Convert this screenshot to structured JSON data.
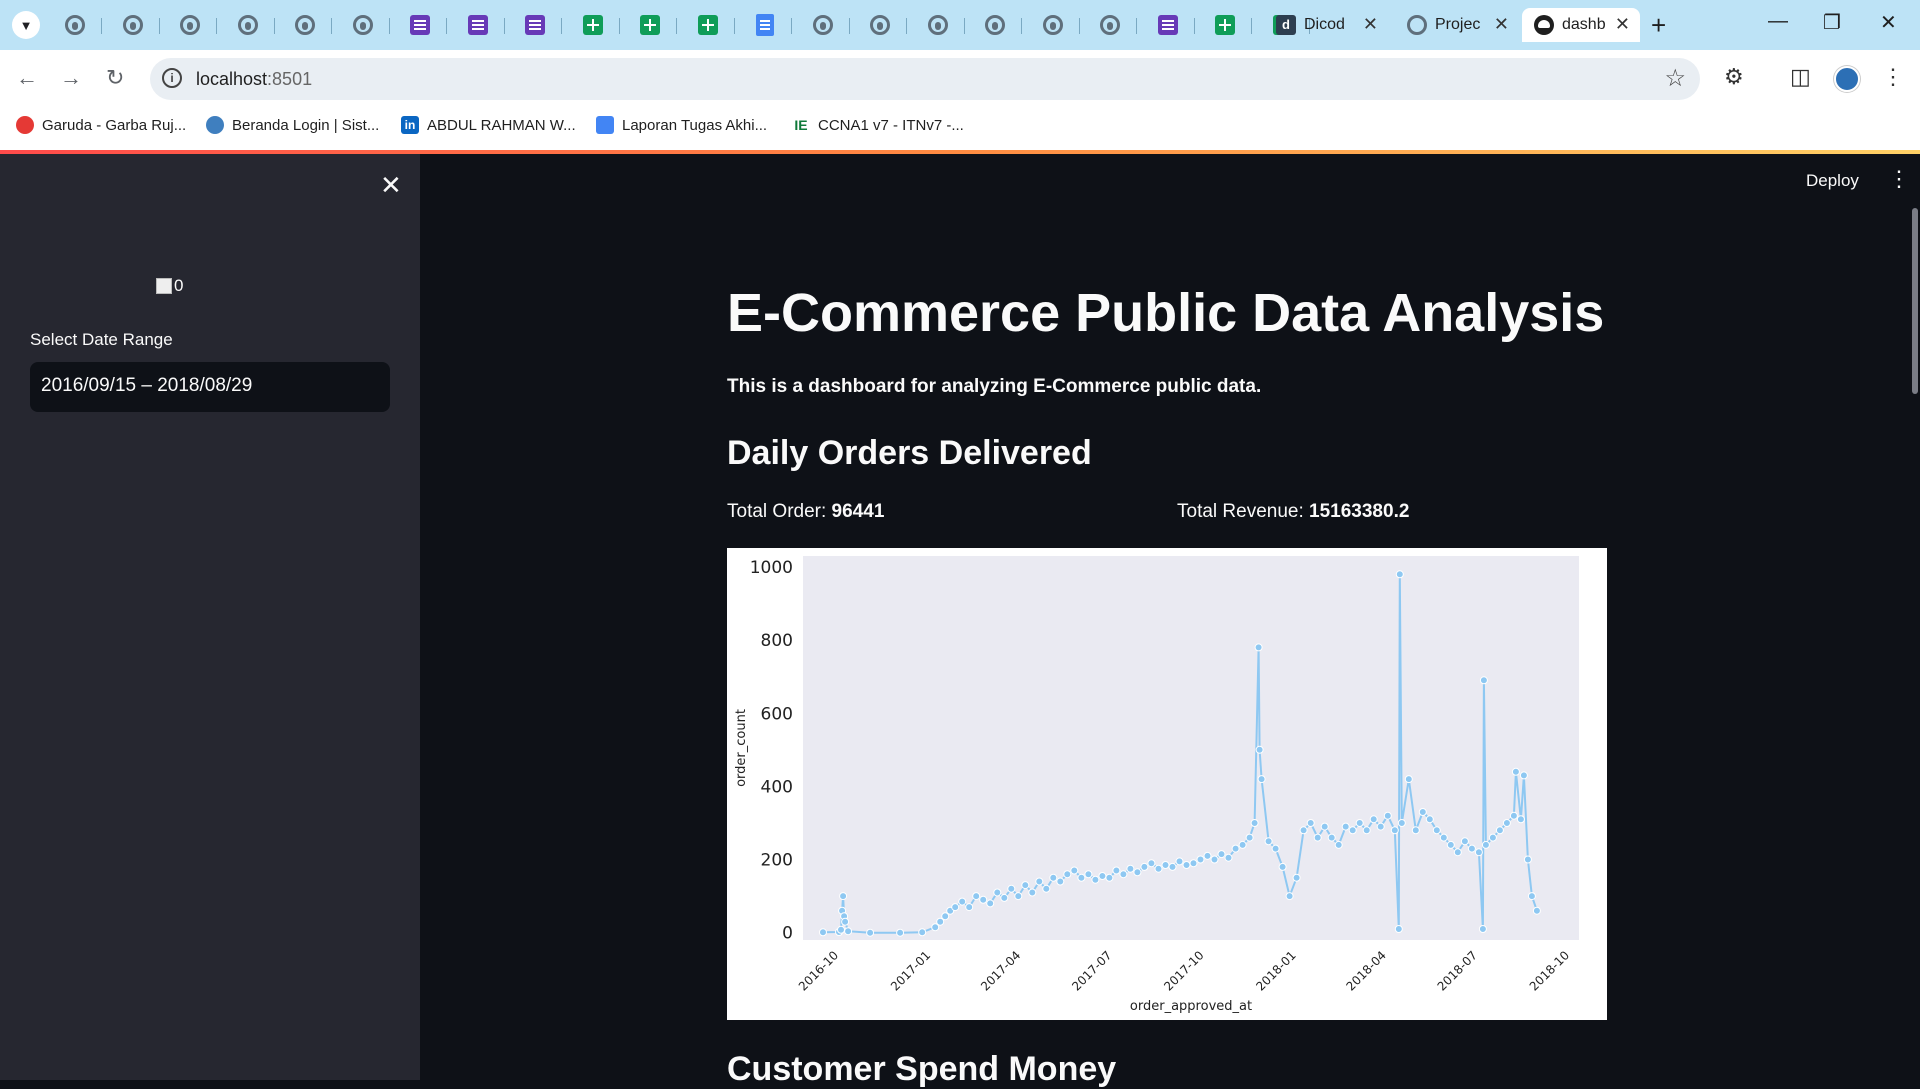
{
  "browser": {
    "pinned_tabs": [
      "github",
      "github",
      "github",
      "github",
      "github",
      "github",
      "forms",
      "forms",
      "forms",
      "sheets",
      "sheets",
      "sheets",
      "docs",
      "github",
      "github",
      "github",
      "github",
      "github",
      "github",
      "forms",
      "sheets",
      "sheets"
    ],
    "tabs": [
      {
        "title": "Dicod",
        "favicon": "dicoding-icon"
      },
      {
        "title": "Projec",
        "favicon": "github-icon"
      },
      {
        "title": "dashb",
        "favicon": "streamlit-icon",
        "active": true
      }
    ],
    "url_host": "localhost",
    "url_port": ":8501",
    "bookmarks": [
      "Garuda - Garba Ruj...",
      "Beranda Login | Sist...",
      "ABDUL RAHMAN W...",
      "Laporan Tugas Akhi...",
      "CCNA1 v7 - ITNv7 -..."
    ]
  },
  "sidebar": {
    "image_alt": "0",
    "date_label": "Select Date Range",
    "date_value": "2016/09/15 – 2018/08/29"
  },
  "header": {
    "deploy_label": "Deploy"
  },
  "main": {
    "title": "E-Commerce Public Data Analysis",
    "subtitle": "This is a dashboard for analyzing E-Commerce public data.",
    "section1": "Daily Orders Delivered",
    "total_order_label": "Total Order: ",
    "total_order_value": "96441",
    "total_revenue_label": "Total Revenue: ",
    "total_revenue_value": "15163380.2",
    "section2": "Customer Spend Money"
  },
  "colors": {
    "accent_line": "#8ec8f2",
    "plot_bg": "#eaeaf2",
    "sidebar_bg": "#262730",
    "app_bg": "#0e1117"
  },
  "chart_data": {
    "type": "line",
    "xlabel": "order_approved_at",
    "ylabel": "order_count",
    "ylim": [
      -20,
      1030
    ],
    "xlim": [
      "2016-08-26",
      "2018-10-10"
    ],
    "x_ticks": [
      "2016-10",
      "2017-01",
      "2017-04",
      "2017-07",
      "2017-10",
      "2018-01",
      "2018-04",
      "2018-07",
      "2018-10"
    ],
    "y_ticks": [
      0,
      200,
      400,
      600,
      800,
      1000
    ],
    "series": [
      {
        "marker": "o",
        "points": [
          [
            "2016-09-15",
            1
          ],
          [
            "2016-10-01",
            2
          ],
          [
            "2016-10-03",
            8
          ],
          [
            "2016-10-04",
            60
          ],
          [
            "2016-10-05",
            100
          ],
          [
            "2016-10-06",
            45
          ],
          [
            "2016-10-07",
            30
          ],
          [
            "2016-10-10",
            4
          ],
          [
            "2016-11-01",
            0
          ],
          [
            "2016-12-01",
            0
          ],
          [
            "2016-12-23",
            1
          ],
          [
            "2017-01-05",
            15
          ],
          [
            "2017-01-10",
            30
          ],
          [
            "2017-01-15",
            45
          ],
          [
            "2017-01-20",
            60
          ],
          [
            "2017-01-25",
            70
          ],
          [
            "2017-02-01",
            85
          ],
          [
            "2017-02-08",
            70
          ],
          [
            "2017-02-15",
            100
          ],
          [
            "2017-02-22",
            90
          ],
          [
            "2017-03-01",
            80
          ],
          [
            "2017-03-08",
            110
          ],
          [
            "2017-03-15",
            95
          ],
          [
            "2017-03-22",
            120
          ],
          [
            "2017-03-29",
            100
          ],
          [
            "2017-04-05",
            130
          ],
          [
            "2017-04-12",
            110
          ],
          [
            "2017-04-19",
            140
          ],
          [
            "2017-04-26",
            120
          ],
          [
            "2017-05-03",
            150
          ],
          [
            "2017-05-10",
            140
          ],
          [
            "2017-05-17",
            160
          ],
          [
            "2017-05-24",
            170
          ],
          [
            "2017-05-31",
            150
          ],
          [
            "2017-06-07",
            160
          ],
          [
            "2017-06-14",
            145
          ],
          [
            "2017-06-21",
            155
          ],
          [
            "2017-06-28",
            150
          ],
          [
            "2017-07-05",
            170
          ],
          [
            "2017-07-12",
            160
          ],
          [
            "2017-07-19",
            175
          ],
          [
            "2017-07-26",
            165
          ],
          [
            "2017-08-02",
            180
          ],
          [
            "2017-08-09",
            190
          ],
          [
            "2017-08-16",
            175
          ],
          [
            "2017-08-23",
            185
          ],
          [
            "2017-08-30",
            180
          ],
          [
            "2017-09-06",
            195
          ],
          [
            "2017-09-13",
            185
          ],
          [
            "2017-09-20",
            190
          ],
          [
            "2017-09-27",
            200
          ],
          [
            "2017-10-04",
            210
          ],
          [
            "2017-10-11",
            200
          ],
          [
            "2017-10-18",
            215
          ],
          [
            "2017-10-25",
            205
          ],
          [
            "2017-11-01",
            230
          ],
          [
            "2017-11-08",
            240
          ],
          [
            "2017-11-15",
            260
          ],
          [
            "2017-11-20",
            300
          ],
          [
            "2017-11-24",
            780
          ],
          [
            "2017-11-25",
            500
          ],
          [
            "2017-11-27",
            420
          ],
          [
            "2017-12-04",
            250
          ],
          [
            "2017-12-11",
            230
          ],
          [
            "2017-12-18",
            180
          ],
          [
            "2017-12-25",
            100
          ],
          [
            "2018-01-01",
            150
          ],
          [
            "2018-01-08",
            280
          ],
          [
            "2018-01-15",
            300
          ],
          [
            "2018-01-22",
            260
          ],
          [
            "2018-01-29",
            290
          ],
          [
            "2018-02-05",
            260
          ],
          [
            "2018-02-12",
            240
          ],
          [
            "2018-02-19",
            290
          ],
          [
            "2018-02-26",
            280
          ],
          [
            "2018-03-05",
            300
          ],
          [
            "2018-03-12",
            280
          ],
          [
            "2018-03-19",
            310
          ],
          [
            "2018-03-26",
            290
          ],
          [
            "2018-04-02",
            320
          ],
          [
            "2018-04-09",
            280
          ],
          [
            "2018-04-13",
            10
          ],
          [
            "2018-04-14",
            980
          ],
          [
            "2018-04-16",
            300
          ],
          [
            "2018-04-23",
            420
          ],
          [
            "2018-04-30",
            280
          ],
          [
            "2018-05-07",
            330
          ],
          [
            "2018-05-14",
            310
          ],
          [
            "2018-05-21",
            280
          ],
          [
            "2018-05-28",
            260
          ],
          [
            "2018-06-04",
            240
          ],
          [
            "2018-06-11",
            220
          ],
          [
            "2018-06-18",
            250
          ],
          [
            "2018-06-25",
            230
          ],
          [
            "2018-07-02",
            220
          ],
          [
            "2018-07-06",
            10
          ],
          [
            "2018-07-07",
            690
          ],
          [
            "2018-07-09",
            240
          ],
          [
            "2018-07-16",
            260
          ],
          [
            "2018-07-23",
            280
          ],
          [
            "2018-07-30",
            300
          ],
          [
            "2018-08-06",
            320
          ],
          [
            "2018-08-08",
            440
          ],
          [
            "2018-08-13",
            310
          ],
          [
            "2018-08-16",
            430
          ],
          [
            "2018-08-20",
            200
          ],
          [
            "2018-08-24",
            100
          ],
          [
            "2018-08-29",
            60
          ]
        ]
      }
    ]
  }
}
